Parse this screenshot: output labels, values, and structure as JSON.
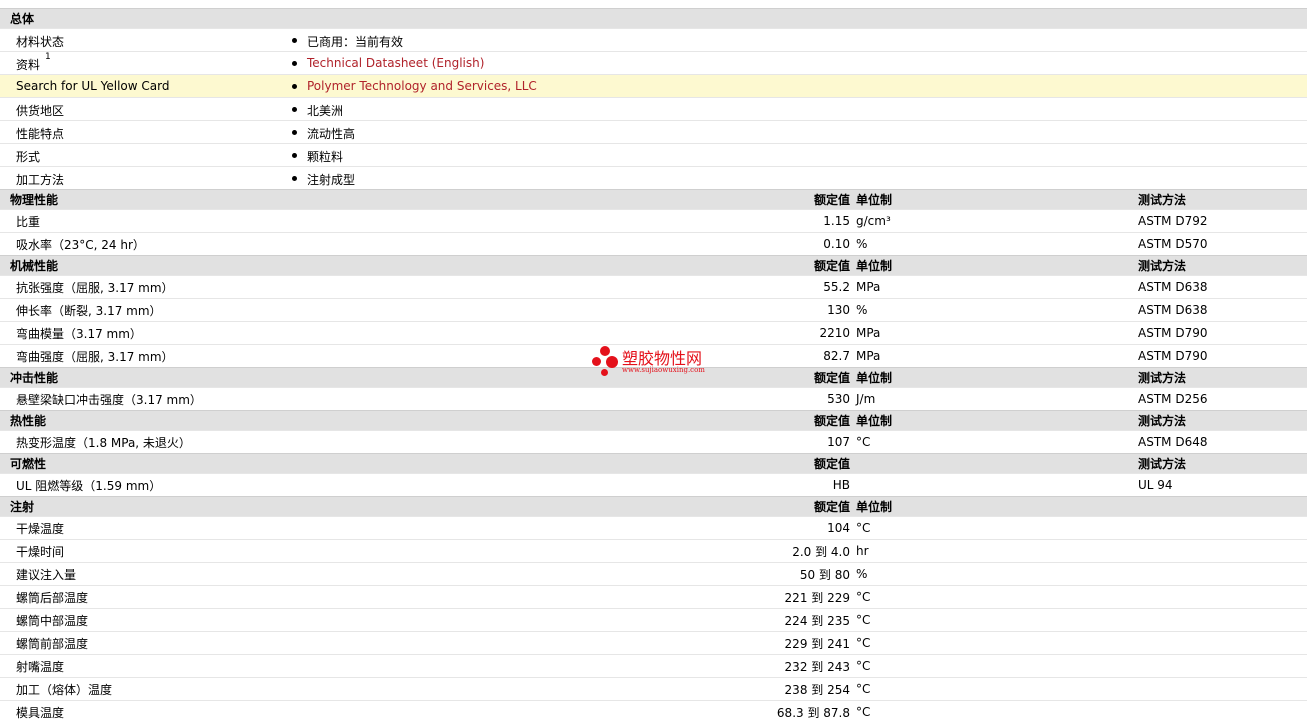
{
  "overview": {
    "title": "总体",
    "rows": [
      {
        "label": "材料状态",
        "value": "已商用：当前有效",
        "link": false
      },
      {
        "label": "资料",
        "sup": "1",
        "value": "Technical Datasheet (English)",
        "link": true
      },
      {
        "label": "Search for UL Yellow Card",
        "value": "Polymer Technology and Services, LLC",
        "link": true,
        "highlight": true
      },
      {
        "label": "供货地区",
        "value": "北美洲",
        "link": false
      },
      {
        "label": "性能特点",
        "value": "流动性高",
        "link": false
      },
      {
        "label": "形式",
        "value": "颗粒料",
        "link": false
      },
      {
        "label": "加工方法",
        "value": "注射成型",
        "link": false
      }
    ]
  },
  "sections": [
    {
      "title": "物理性能",
      "value_header": "额定值",
      "unit_header": "单位制",
      "method_header": "测试方法",
      "rows": [
        {
          "label": "比重",
          "value": "1.15",
          "unit": "g/cm³",
          "method": "ASTM D792"
        },
        {
          "label": "吸水率（23°C, 24 hr）",
          "value": "0.10",
          "unit": "%",
          "method": "ASTM D570"
        }
      ]
    },
    {
      "title": "机械性能",
      "value_header": "额定值",
      "unit_header": "单位制",
      "method_header": "测试方法",
      "rows": [
        {
          "label": "抗张强度（屈服, 3.17 mm）",
          "value": "55.2",
          "unit": "MPa",
          "method": "ASTM D638"
        },
        {
          "label": "伸长率（断裂, 3.17 mm）",
          "value": "130",
          "unit": "%",
          "method": "ASTM D638"
        },
        {
          "label": "弯曲模量（3.17 mm）",
          "value": "2210",
          "unit": "MPa",
          "method": "ASTM D790"
        },
        {
          "label": "弯曲强度（屈服, 3.17 mm）",
          "value": "82.7",
          "unit": "MPa",
          "method": "ASTM D790"
        }
      ]
    },
    {
      "title": "冲击性能",
      "value_header": "额定值",
      "unit_header": "单位制",
      "method_header": "测试方法",
      "rows": [
        {
          "label": "悬壁梁缺口冲击强度（3.17 mm）",
          "value": "530",
          "unit": "J/m",
          "method": "ASTM D256"
        }
      ]
    },
    {
      "title": "热性能",
      "value_header": "额定值",
      "unit_header": "单位制",
      "method_header": "测试方法",
      "rows": [
        {
          "label": "热变形温度（1.8 MPa, 未退火）",
          "value": "107",
          "unit": "°C",
          "method": "ASTM D648"
        }
      ]
    },
    {
      "title": "可燃性",
      "value_header": "额定值",
      "unit_header": "",
      "method_header": "测试方法",
      "rows": [
        {
          "label": "UL 阻燃等级（1.59 mm）",
          "value": "HB",
          "unit": "",
          "method": "UL 94"
        }
      ]
    },
    {
      "title": "注射",
      "value_header": "额定值",
      "unit_header": "单位制",
      "method_header": "",
      "rows": [
        {
          "label": "干燥温度",
          "value": "104",
          "unit": "°C",
          "method": ""
        },
        {
          "label": "干燥时间",
          "value": "2.0 到  4.0",
          "unit": "hr",
          "method": ""
        },
        {
          "label": "建议注入量",
          "value": "50 到  80",
          "unit": "%",
          "method": ""
        },
        {
          "label": "螺筒后部温度",
          "value": "221 到  229",
          "unit": "°C",
          "method": ""
        },
        {
          "label": "螺筒中部温度",
          "value": "224 到  235",
          "unit": "°C",
          "method": ""
        },
        {
          "label": "螺筒前部温度",
          "value": "229 到  241",
          "unit": "°C",
          "method": ""
        },
        {
          "label": "射嘴温度",
          "value": "232 到  243",
          "unit": "°C",
          "method": ""
        },
        {
          "label": "加工（熔体）温度",
          "value": "238 到  254",
          "unit": "°C",
          "method": ""
        },
        {
          "label": "模具温度",
          "value": "68.3 到  87.8",
          "unit": "°C",
          "method": ""
        }
      ]
    }
  ],
  "watermark": {
    "brand": "塑胶物性网",
    "url": "www.sujiaowuxing.com"
  },
  "colors": {
    "section_bg": "#e1e1e1",
    "link": "#b0222a",
    "highlight": "#fdf9d0",
    "watermark": "#e4111b"
  }
}
